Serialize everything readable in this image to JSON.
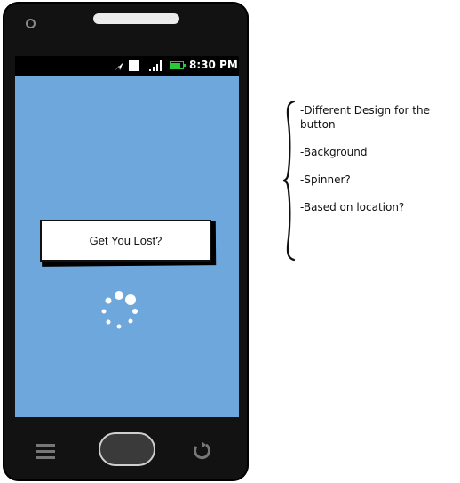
{
  "status_bar": {
    "time": "8:30 PM",
    "icons": [
      "navigation-arrow-icon",
      "sim-card-icon",
      "signal-strength-icon",
      "battery-icon"
    ],
    "battery_color": "#29c93b"
  },
  "screen": {
    "background_color": "#6ea7dc",
    "cta_button_label": "Get You Lost?",
    "loading_indicator": "spinner-icon"
  },
  "device": {
    "icons": [
      "camera-icon",
      "speaker-icon",
      "menu-icon",
      "home-button",
      "back-icon"
    ]
  },
  "notes": {
    "items": [
      "-Different Design for the button",
      "-Background",
      "-Spinner?",
      "-Based on location?"
    ]
  }
}
